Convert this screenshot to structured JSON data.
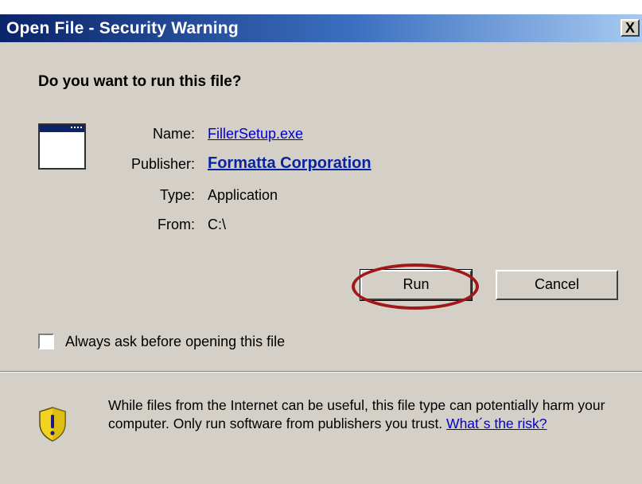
{
  "window": {
    "title": "Open File - Security Warning",
    "close_symbol": "X"
  },
  "dialog": {
    "question": "Do you want to run this file?",
    "fields": [
      {
        "label": "Name:",
        "value": "FillerSetup.exe"
      },
      {
        "label": "Publisher:",
        "value": "Formatta Corporation"
      },
      {
        "label": "Type:",
        "value": "Application"
      },
      {
        "label": "From:",
        "value": "C:\\"
      }
    ],
    "buttons": {
      "run": "Run",
      "cancel": "Cancel"
    },
    "checkbox": {
      "label": "Always ask before opening this file",
      "checked": false
    },
    "warning": {
      "text": "While files from the Internet can be useful, this file type can potentially harm your computer. Only run software from publishers you trust.",
      "link": "What´s the risk?"
    }
  },
  "icons": {
    "app": "application-window-icon",
    "shield": "security-shield-warning-icon"
  },
  "colors": {
    "title_bar_start": "#0a246a",
    "title_bar_end": "#a6caf0",
    "highlight_ellipse": "#a01818",
    "shield": "#f2d21a"
  }
}
